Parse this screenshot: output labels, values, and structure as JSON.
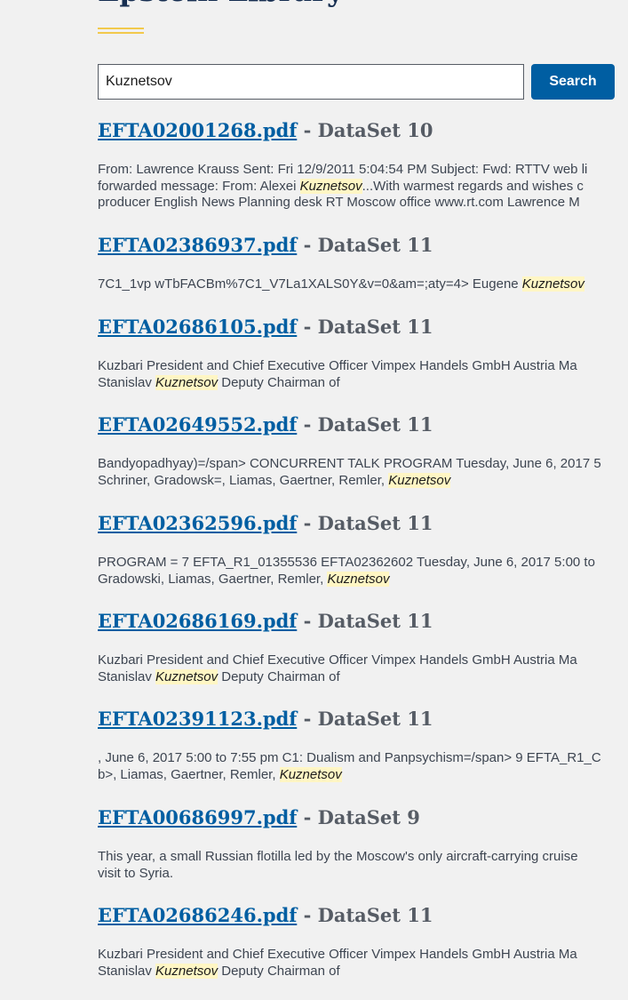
{
  "header": {
    "title": "Epstein Library"
  },
  "search": {
    "value": "Kuznetsov",
    "button_label": "Search"
  },
  "results": [
    {
      "file": "EFTA02001268.pdf",
      "separator": "-",
      "dataset": "DataSet 10",
      "snippet_lines": [
        [
          {
            "t": "From: Lawrence Krauss Sent: Fri 12/9/2011 5:04:54 PM Subject: Fwd: RTTV web li"
          }
        ],
        [
          {
            "t": "forwarded message: From: Alexei "
          },
          {
            "t": "Kuznetsov",
            "hl": true
          },
          {
            "t": "...With warmest regards and wishes c"
          }
        ],
        [
          {
            "t": "producer English News Planning desk RT Moscow office www.rt.com Lawrence M"
          }
        ]
      ]
    },
    {
      "file": "EFTA02386937.pdf",
      "separator": "-",
      "dataset": "DataSet 11",
      "snippet_lines": [
        [
          {
            "t": "7C1_1vp wTbFACBm%7C1_V7La1XALS0Y&v=0&am=;aty=4> Eugene "
          },
          {
            "t": "Kuznetsov",
            "hl": true
          }
        ]
      ]
    },
    {
      "file": "EFTA02686105.pdf",
      "separator": "-",
      "dataset": "DataSet 11",
      "snippet_lines": [
        [
          {
            "t": "Kuzbari President and Chief Executive Officer Vimpex Handels GmbH Austria Ma"
          }
        ],
        [
          {
            "t": "Stanislav "
          },
          {
            "t": "Kuznetsov",
            "hl": true
          },
          {
            "t": " Deputy Chairman of"
          }
        ]
      ]
    },
    {
      "file": "EFTA02649552.pdf",
      "separator": "-",
      "dataset": "DataSet 11",
      "snippet_lines": [
        [
          {
            "t": "Bandyopadhyay)=/span> CONCURRENT TALK PROGRAM Tuesday, June 6, 2017 5"
          }
        ],
        [
          {
            "t": "Schriner, Gradowsk=, Liamas, Gaertner, Remler, "
          },
          {
            "t": "Kuznetsov",
            "hl": true
          }
        ]
      ]
    },
    {
      "file": "EFTA02362596.pdf",
      "separator": "-",
      "dataset": "DataSet 11",
      "snippet_lines": [
        [
          {
            "t": "PROGRAM = 7 EFTA_R1_01355536 EFTA02362602 Tuesday, June 6, 2017 5:00 to"
          }
        ],
        [
          {
            "t": "Gradowski, Liamas, Gaertner, Remler, "
          },
          {
            "t": "Kuznetsov",
            "hl": true
          }
        ]
      ]
    },
    {
      "file": "EFTA02686169.pdf",
      "separator": "-",
      "dataset": "DataSet 11",
      "snippet_lines": [
        [
          {
            "t": "Kuzbari President and Chief Executive Officer Vimpex Handels GmbH Austria Ma"
          }
        ],
        [
          {
            "t": "Stanislav "
          },
          {
            "t": "Kuznetsov",
            "hl": true
          },
          {
            "t": " Deputy Chairman of"
          }
        ]
      ]
    },
    {
      "file": "EFTA02391123.pdf",
      "separator": "-",
      "dataset": "DataSet 11",
      "snippet_lines": [
        [
          {
            "t": ", June 6, 2017 5:00 to 7:55 pm C1: Dualism and Panpsychism=/span> 9 EFTA_R1_C"
          }
        ],
        [
          {
            "t": "b>, Liamas, Gaertner, Remler, "
          },
          {
            "t": "Kuznetsov",
            "hl": true
          }
        ]
      ]
    },
    {
      "file": "EFTA00686997.pdf",
      "separator": "-",
      "dataset": "DataSet 9",
      "snippet_lines": [
        [
          {
            "t": "This year, a small Russian flotilla led by the Moscow's only aircraft-carrying cruise"
          }
        ],
        [
          {
            "t": "visit to Syria."
          }
        ]
      ]
    },
    {
      "file": "EFTA02686246.pdf",
      "separator": "-",
      "dataset": "DataSet 11",
      "snippet_lines": [
        [
          {
            "t": "Kuzbari President and Chief Executive Officer Vimpex Handels GmbH Austria Ma"
          }
        ],
        [
          {
            "t": "Stanislav "
          },
          {
            "t": "Kuznetsov",
            "hl": true
          },
          {
            "t": " Deputy Chairman of"
          }
        ]
      ]
    }
  ],
  "colors": {
    "link": "#005ea2",
    "button": "#005ea2",
    "accent": "#f2c94c",
    "highlight": "#fff6c4",
    "background": "#f1f1f1"
  }
}
